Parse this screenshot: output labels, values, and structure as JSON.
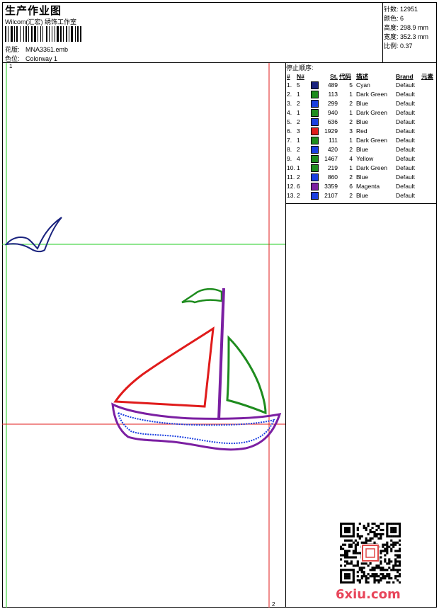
{
  "header": {
    "title": "生产作业图",
    "company": "Wilcom(汇宏) 绣饰工作室",
    "design_label": "花版:",
    "design_file": "MNA3361.emb",
    "colorway_label": "色位:",
    "colorway": "Colorway 1"
  },
  "stats": [
    {
      "label": "针数:",
      "value": "12951"
    },
    {
      "label": "颜色:",
      "value": "6"
    },
    {
      "label": "高度:",
      "value": "298.9 mm"
    },
    {
      "label": "宽度:",
      "value": "352.3 mm"
    },
    {
      "label": "比例:",
      "value": "0.37"
    }
  ],
  "stop_sequence": {
    "heading": "停止顺序:",
    "columns": [
      "#",
      "N#",
      "St.",
      "代码",
      "描述",
      "Brand",
      "元素"
    ],
    "rows": [
      {
        "idx": "1.",
        "n": "5",
        "color": "#1a237e",
        "st": "489",
        "code": "5",
        "desc": "Cyan",
        "brand": "Default"
      },
      {
        "idx": "2.",
        "n": "1",
        "color": "#1e8c1e",
        "st": "113",
        "code": "1",
        "desc": "Dark Green",
        "brand": "Default"
      },
      {
        "idx": "3.",
        "n": "2",
        "color": "#1a3fe0",
        "st": "299",
        "code": "2",
        "desc": "Blue",
        "brand": "Default"
      },
      {
        "idx": "4.",
        "n": "1",
        "color": "#1e8c1e",
        "st": "940",
        "code": "1",
        "desc": "Dark Green",
        "brand": "Default"
      },
      {
        "idx": "5.",
        "n": "2",
        "color": "#1a3fe0",
        "st": "636",
        "code": "2",
        "desc": "Blue",
        "brand": "Default"
      },
      {
        "idx": "6.",
        "n": "3",
        "color": "#e01b1b",
        "st": "1929",
        "code": "3",
        "desc": "Red",
        "brand": "Default"
      },
      {
        "idx": "7.",
        "n": "1",
        "color": "#1e8c1e",
        "st": "111",
        "code": "1",
        "desc": "Dark Green",
        "brand": "Default"
      },
      {
        "idx": "8.",
        "n": "2",
        "color": "#1a3fe0",
        "st": "420",
        "code": "2",
        "desc": "Blue",
        "brand": "Default"
      },
      {
        "idx": "9.",
        "n": "4",
        "color": "#1e8c1e",
        "st": "1467",
        "code": "4",
        "desc": "Yellow",
        "brand": "Default"
      },
      {
        "idx": "10.",
        "n": "1",
        "color": "#1e8c1e",
        "st": "219",
        "code": "1",
        "desc": "Dark Green",
        "brand": "Default"
      },
      {
        "idx": "11.",
        "n": "2",
        "color": "#1a3fe0",
        "st": "860",
        "code": "2",
        "desc": "Blue",
        "brand": "Default"
      },
      {
        "idx": "12.",
        "n": "6",
        "color": "#7b1fa2",
        "st": "3359",
        "code": "6",
        "desc": "Magenta",
        "brand": "Default"
      },
      {
        "idx": "13.",
        "n": "2",
        "color": "#1a3fe0",
        "st": "2107",
        "code": "2",
        "desc": "Blue",
        "brand": "Default"
      }
    ]
  },
  "preview": {
    "corner_top_left": "1",
    "corner_bottom_right": "2"
  },
  "colors": {
    "guide_green": "#22cc22",
    "guide_red": "#e01b1b",
    "seagull": "#1a237e",
    "flag": "#1e8c1e",
    "mast": "#7b1fa2",
    "sail_red": "#e01b1b",
    "sail_green": "#1e8c1e",
    "hull_outer": "#7b1fa2",
    "hull_stitch": "#1a3fe0"
  },
  "watermark": "6xiu.com"
}
